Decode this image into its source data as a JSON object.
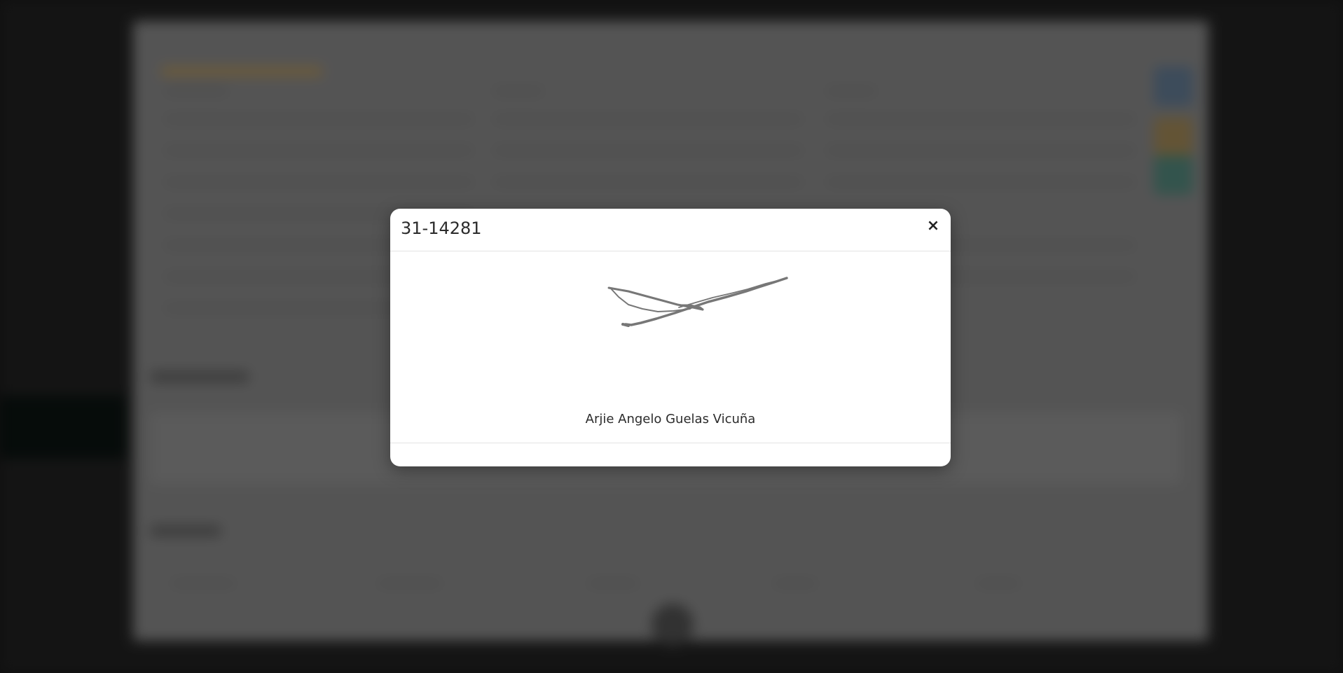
{
  "modal": {
    "title": "31-14281",
    "close_label": "×",
    "signer_name": "Arjie Angelo Guelas Vicuña"
  },
  "icons": {
    "close": "close-icon",
    "signature": "signature-image"
  },
  "colors": {
    "overlay": "#262626",
    "modal_background": "#ffffff",
    "signature_stroke": "#777777"
  }
}
